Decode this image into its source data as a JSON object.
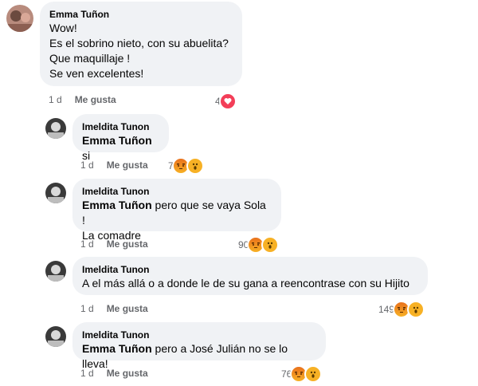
{
  "comments": [
    {
      "author": "Emma Tuñon",
      "tag": "",
      "text": "Wow!\nEs el sobrino nieto, con su abuelita?\nQue maquillaje !\nSe ven excelentes!",
      "time": "1 d",
      "like_label": "Me gusta",
      "reaction_count": "4",
      "reactions": [
        "heart-icon"
      ]
    },
    {
      "author": "Imeldita Tunon",
      "tag": "Emma Tuñon",
      "text": " si",
      "time": "1 d",
      "like_label": "Me gusta",
      "reaction_count": "7",
      "reactions": [
        "angry-icon",
        "wow-icon"
      ]
    },
    {
      "author": "Imeldita Tunon",
      "tag": "Emma Tuñon",
      "text": " pero que se vaya Sola !\nLa comadre",
      "time": "1 d",
      "like_label": "Me gusta",
      "reaction_count": "90",
      "reactions": [
        "angry-icon",
        "wow-icon"
      ]
    },
    {
      "author": "Imeldita Tunon",
      "tag": "",
      "text": "A el más allá o a donde le de su gana a reencontrase con su Hijito",
      "time": "1 d",
      "like_label": "Me gusta",
      "reaction_count": "149",
      "reactions": [
        "angry-icon",
        "wow-icon"
      ]
    },
    {
      "author": "Imeldita Tunon",
      "tag": "Emma Tuñon",
      "text": " pero a José Julián no se lo lleva!",
      "time": "1 d",
      "like_label": "Me gusta",
      "reaction_count": "76",
      "reactions": [
        "angry-icon",
        "wow-icon"
      ]
    }
  ],
  "colors": {
    "bubble": "#f0f2f5",
    "meta_text": "#65676b",
    "heart": "#f33e58",
    "angry": "#e9711c",
    "wow": "#f7b125"
  }
}
